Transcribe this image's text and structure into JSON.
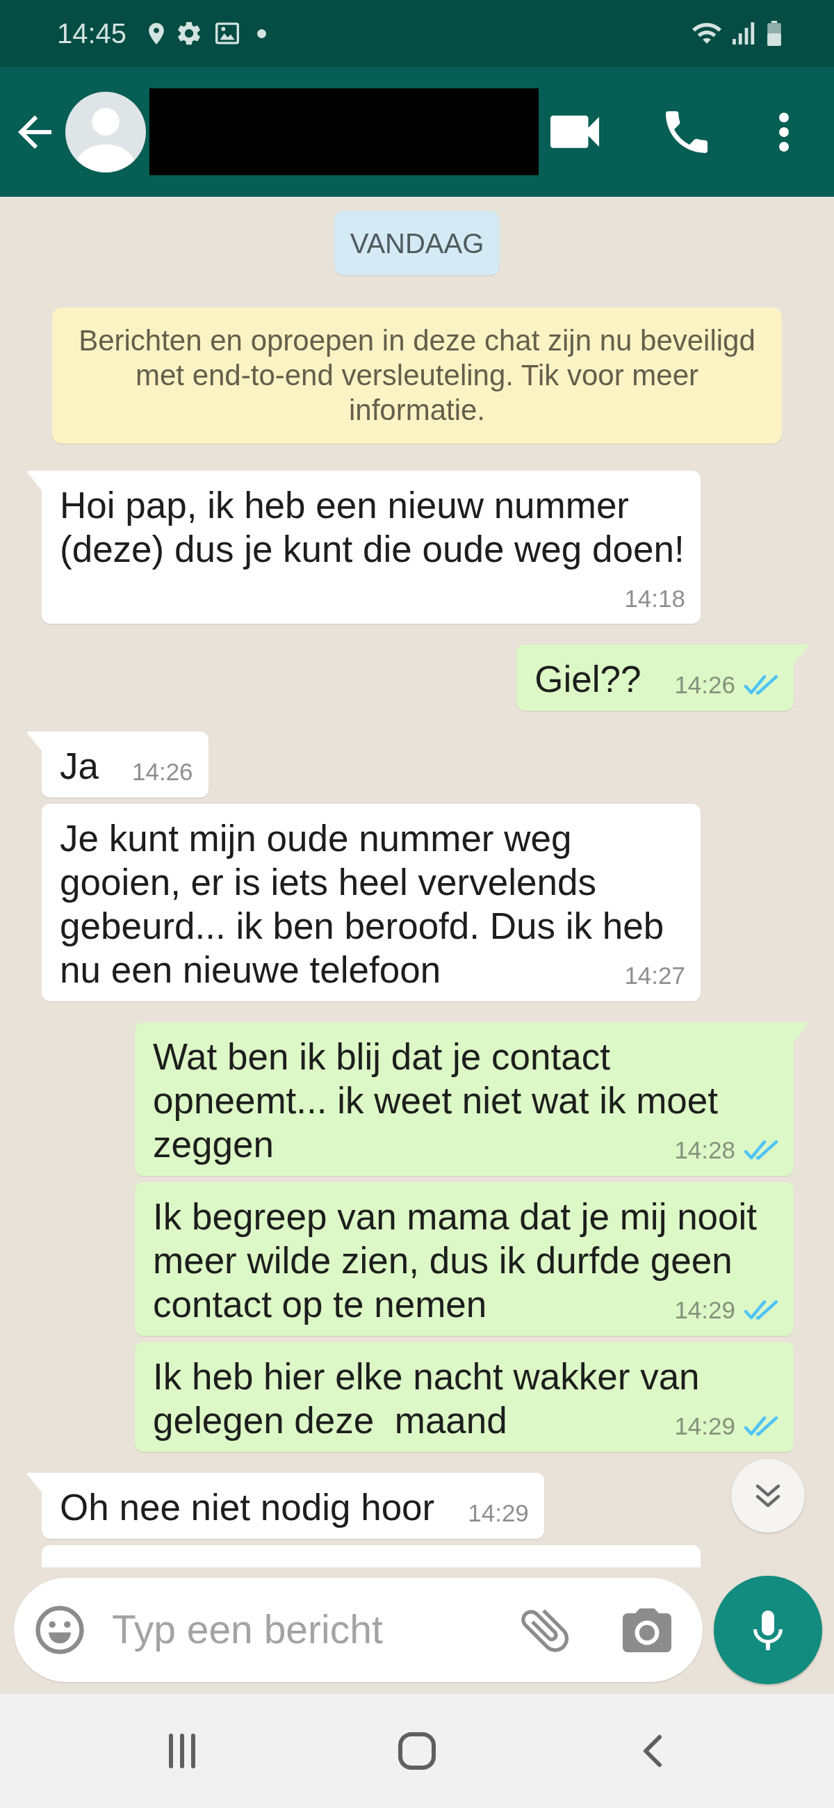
{
  "status_bar": {
    "time": "14:45"
  },
  "header": {
    "name_redacted": true
  },
  "date_label": "VANDAAG",
  "encryption_notice": "Berichten en oproepen in deze chat zijn nu beveiligd met end-to-end versleuteling. Tik voor meer informatie.",
  "messages": [
    {
      "kind": "text",
      "outgoing": false,
      "tail": true,
      "text": "Hoi pap, ik heb een nieuw nummer (deze) dus je kunt die oude weg doen!",
      "time": "14:18"
    },
    {
      "kind": "text",
      "outgoing": true,
      "tail": true,
      "text": "Giel??",
      "time": "14:26",
      "read": true
    },
    {
      "kind": "text",
      "outgoing": false,
      "tail": true,
      "text": "Ja",
      "time": "14:26"
    },
    {
      "kind": "text",
      "outgoing": false,
      "tail": false,
      "text": "Je kunt mijn oude nummer weg gooien, er is iets heel vervelends gebeurd... ik ben beroofd. Dus ik heb nu een nieuwe telefoon",
      "time": "14:27"
    },
    {
      "kind": "text",
      "outgoing": true,
      "tail": true,
      "text": "Wat ben ik blij dat je contact opneemt... ik weet niet wat ik moet zeggen",
      "time": "14:28",
      "read": true
    },
    {
      "kind": "text",
      "outgoing": true,
      "tail": false,
      "text": "Ik begreep van mama dat je mij nooit meer wilde zien, dus ik durfde geen contact op te nemen",
      "time": "14:29",
      "read": true
    },
    {
      "kind": "text",
      "outgoing": true,
      "tail": false,
      "text": "Ik heb hier elke nacht wakker van gelegen deze  maand",
      "time": "14:29",
      "read": true
    },
    {
      "kind": "text",
      "outgoing": false,
      "tail": true,
      "text": "Oh nee niet nodig hoor",
      "time": "14:29"
    },
    {
      "kind": "partial",
      "outgoing": false,
      "tail": false
    }
  ],
  "composer": {
    "placeholder": "Typ een bericht"
  }
}
